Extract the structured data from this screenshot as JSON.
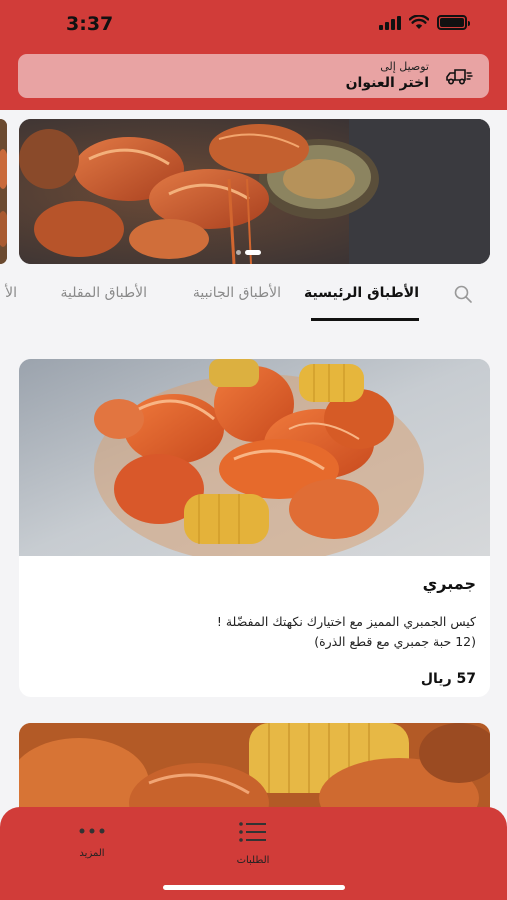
{
  "status_bar": {
    "time": "3:37"
  },
  "delivery": {
    "small_label": "توصيل إلى",
    "address_label": "اختر العنوان",
    "icon": "delivery-truck-icon"
  },
  "banner": {
    "slide_count": 2,
    "active_slide": 2
  },
  "tabs": [
    {
      "label": "الأطباق الرئيسية",
      "active": true
    },
    {
      "label": "الأطباق الجانبية",
      "active": false
    },
    {
      "label": "الأطباق المقلية",
      "active": false
    },
    {
      "label": "الأ",
      "active": false
    }
  ],
  "product": {
    "title": "جمبري",
    "description_line1": "كيس الجمبري المميز مع اختيارك نكهتك المفضّلة !",
    "description_line2": "(12 حبة جمبري مع قطع الذرة)",
    "price": "57 ريال"
  },
  "bottom_nav": {
    "orders_label": "الطلبات",
    "more_label": "المزيد"
  },
  "colors": {
    "brand": "#d13c39",
    "delivery_bar": "#e8a3a3"
  }
}
